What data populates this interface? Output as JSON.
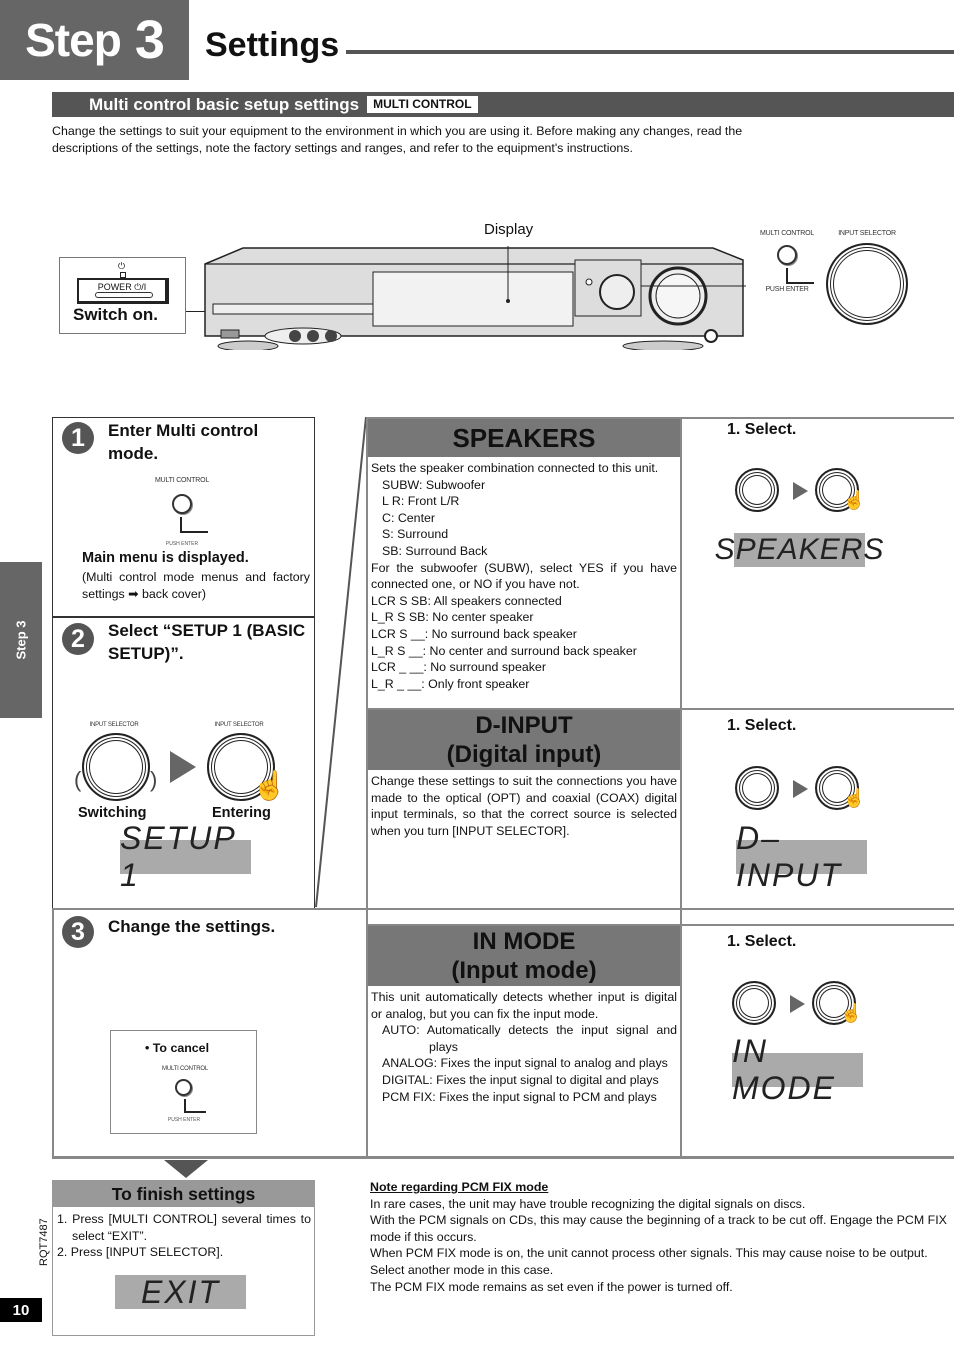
{
  "header": {
    "step_word": "Step",
    "step_number": "3",
    "title": "Settings"
  },
  "section": {
    "title": "Multi control basic setup settings",
    "tag": "MULTI CONTROL",
    "intro": "Change the settings to suit your equipment to the environment in which you are using it. Before making any changes, read the descriptions of the settings, note the factory settings and ranges, and refer to the equipment's instructions."
  },
  "device_illustration": {
    "display_label": "Display",
    "switch_on": "Switch on.",
    "power_label": "POWER ⏻/I",
    "power_symbol": "⏻",
    "multi_control_label": "MULTI CONTROL",
    "push_enter_label": "PUSH ENTER",
    "input_selector_label": "INPUT SELECTOR"
  },
  "side_tab": {
    "label": "Step 3"
  },
  "steps": [
    {
      "number": "1",
      "heading": "Enter Multi control mode.",
      "multi_control_label": "MULTI CONTROL",
      "push_enter_label": "PUSH ENTER",
      "result": "Main menu is displayed.",
      "note": "(Multi control mode menus and factory settings ➡ back cover)"
    },
    {
      "number": "2",
      "heading": "Select “SETUP 1 (BASIC SETUP)”.",
      "selector_label": "INPUT SELECTOR",
      "switching_label": "Switching",
      "entering_label": "Entering",
      "display": "SETUP  1"
    },
    {
      "number": "3",
      "heading": "Change the settings.",
      "cancel_label": "• To cancel",
      "multi_control_label": "MULTI CONTROL",
      "push_enter_label": "PUSH ENTER"
    }
  ],
  "settings": [
    {
      "title": "SPEAKERS",
      "subtitle": "",
      "select_label": "1. Select.",
      "display": "SPEAKERS",
      "lines": [
        {
          "text": "Sets the speaker combination connected to this unit.",
          "indent": false
        },
        {
          "text": "SUBW: Subwoofer",
          "indent": true
        },
        {
          "text": "L R: Front L/R",
          "indent": true
        },
        {
          "text": "C: Center",
          "indent": true
        },
        {
          "text": "S: Surround",
          "indent": true
        },
        {
          "text": "SB: Surround Back",
          "indent": true
        },
        {
          "text": "For the subwoofer (SUBW), select YES if you have connected one, or NO if you have not.",
          "indent": false
        },
        {
          "text": "LCR S SB: All speakers connected",
          "indent": false
        },
        {
          "text": "L_R S SB: No center speaker",
          "indent": false
        },
        {
          "text": "LCR S __: No surround back speaker",
          "indent": false
        },
        {
          "text": "L_R S __: No center and surround back speaker",
          "indent": false
        },
        {
          "text": "LCR _ __: No surround speaker",
          "indent": false
        },
        {
          "text": "L_R _ __: Only front speaker",
          "indent": false
        }
      ]
    },
    {
      "title": "D-INPUT",
      "subtitle": "(Digital input)",
      "select_label": "1. Select.",
      "display": "D–INPUT",
      "lines": [
        {
          "text": "Change these settings to suit the connections you have made to the optical (OPT) and coaxial (COAX) digital input terminals, so that the correct source is selected when you turn [INPUT SELECTOR].",
          "indent": false
        }
      ]
    },
    {
      "title": "IN MODE",
      "subtitle": "(Input mode)",
      "select_label": "1. Select.",
      "display": "IN MODE",
      "lines": [
        {
          "text": "This unit automatically detects whether input is digital or analog, but you can fix the input mode.",
          "indent": false
        },
        {
          "text": "AUTO: Automatically detects the input signal and plays",
          "indent": true
        },
        {
          "text": "ANALOG: Fixes the input signal to analog and plays",
          "indent": true
        },
        {
          "text": "DIGITAL: Fixes the input signal to digital and plays",
          "indent": true
        },
        {
          "text": "PCM FIX: Fixes the input signal to PCM and plays",
          "indent": true
        }
      ]
    }
  ],
  "finish": {
    "title": "To finish settings",
    "items": [
      "1. Press [MULTI CONTROL] several times to select “EXIT”.",
      "2. Press [INPUT SELECTOR]."
    ],
    "display": "EXIT"
  },
  "note": {
    "title": "Note regarding PCM FIX mode",
    "paragraphs": [
      "In rare cases, the unit may have trouble recognizing the digital signals on discs.",
      "With the PCM signals on CDs, this may cause the beginning of a track to be cut off. Engage the PCM FIX mode if this occurs.",
      "When PCM FIX mode is on, the unit cannot process other signals. This may cause noise to be output. Select another mode in this case.",
      "The PCM FIX mode remains as set even if the power is turned off."
    ]
  },
  "footer": {
    "model_code": "RQT7487",
    "page_number": "10"
  },
  "colors": {
    "dark_gray": "#555555",
    "mid_gray": "#777777",
    "lcd_gray": "#aaaaaa"
  }
}
